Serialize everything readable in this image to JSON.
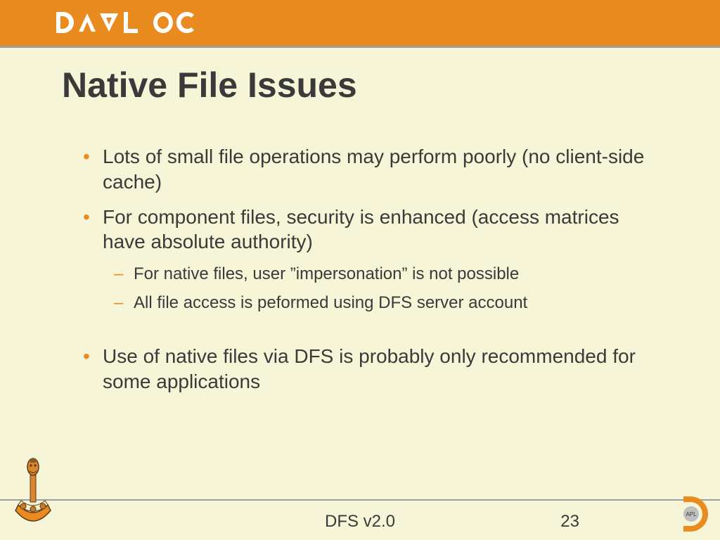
{
  "header": {
    "brand": "DYALOG"
  },
  "title": "Native File Issues",
  "bullets": {
    "b1": "Lots of small file operations may perform poorly (no client-side cache)",
    "b2": "For component files, security is enhanced (access matrices have absolute authority)",
    "b2a": "For native files, user ”impersonation” is not possible",
    "b2b": "All file access is peformed using DFS server account",
    "b3": "Use of native files via DFS is probably only recommended for some applications"
  },
  "footer": {
    "text": "DFS v2.0",
    "page": "23",
    "apl_label": "APL"
  }
}
